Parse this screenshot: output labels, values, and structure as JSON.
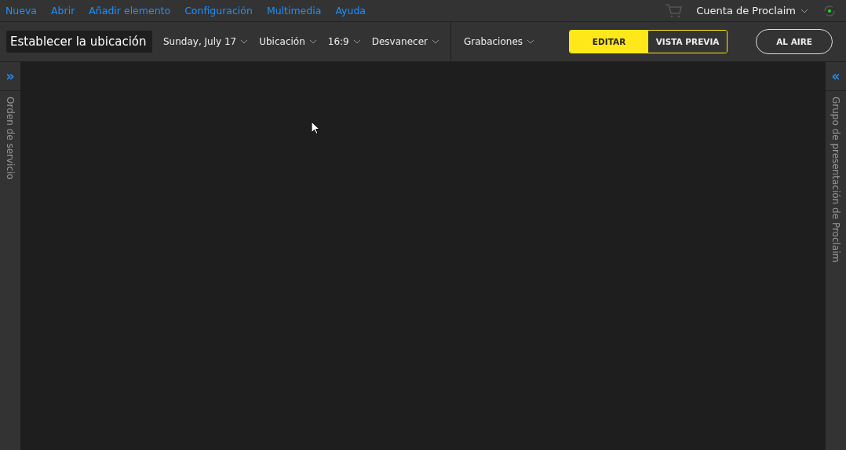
{
  "menu": [
    "Nueva",
    "Abrir",
    "Añadir elemento",
    "Configuración",
    "Multimedia",
    "Ayuda"
  ],
  "account": {
    "label": "Cuenta de Proclaim",
    "online": true
  },
  "toolbar": {
    "location_field": {
      "value": "Establecer la ubicación"
    },
    "dropdowns": [
      {
        "label": "Sunday, July 17"
      },
      {
        "label": "Ubicación"
      },
      {
        "label": "16:9"
      },
      {
        "label": "Desvanecer"
      }
    ],
    "recordings": {
      "label": "Grabaciones"
    },
    "modes": [
      {
        "label": "EDITAR",
        "selected": true
      },
      {
        "label": "VISTA PREVIA",
        "selected": false
      }
    ],
    "on_air": {
      "label": "AL AIRE"
    }
  },
  "left_panel": {
    "toggle": "»",
    "title": "Orden de servicio"
  },
  "right_panel": {
    "toggle": "«",
    "title": "Grupo de presentación de Proclaim"
  }
}
